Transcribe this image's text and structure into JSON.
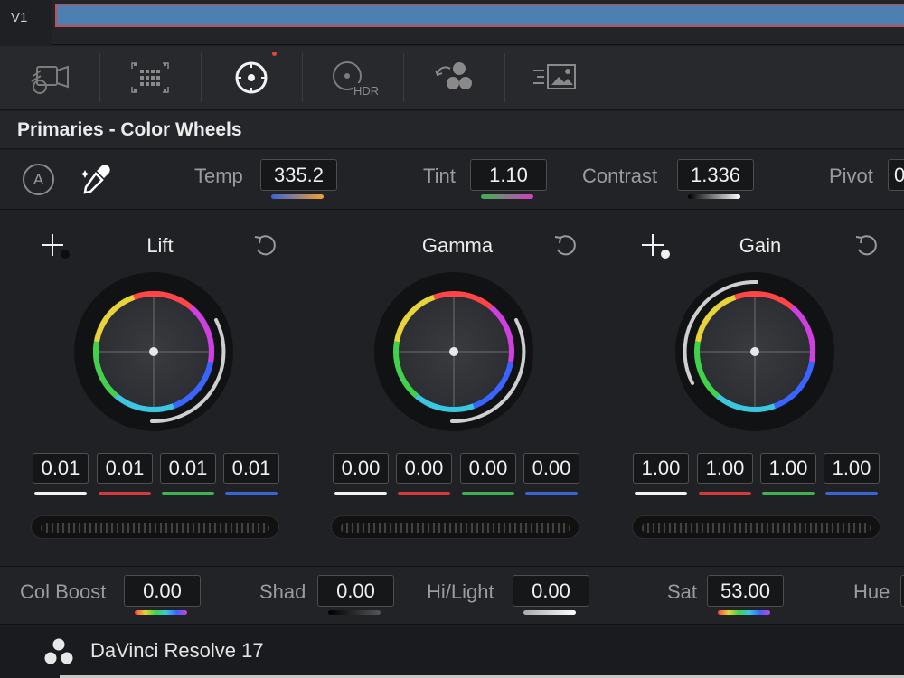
{
  "timeline": {
    "track_label": "V1"
  },
  "toolbar": {
    "tools": [
      {
        "name": "camera-raw-icon"
      },
      {
        "name": "color-match-icon"
      },
      {
        "name": "primaries-icon",
        "active": true
      },
      {
        "name": "hdr-icon",
        "text": "HDR"
      },
      {
        "name": "rgb-mixer-icon"
      },
      {
        "name": "motion-effects-icon"
      }
    ]
  },
  "palette": {
    "title": "Primaries - Color Wheels"
  },
  "adjust": {
    "auto_label": "A",
    "temp_label": "Temp",
    "temp_value": "335.2",
    "tint_label": "Tint",
    "tint_value": "1.10",
    "contrast_label": "Contrast",
    "contrast_value": "1.336",
    "pivot_label": "Pivot",
    "pivot_value": "0"
  },
  "wheels": [
    {
      "title": "Lift",
      "values": [
        "0.01",
        "0.01",
        "0.01",
        "0.01"
      ]
    },
    {
      "title": "Gamma",
      "values": [
        "0.00",
        "0.00",
        "0.00",
        "0.00"
      ]
    },
    {
      "title": "Gain",
      "values": [
        "1.00",
        "1.00",
        "1.00",
        "1.00"
      ]
    }
  ],
  "bottom": {
    "col_boost_label": "Col Boost",
    "col_boost_value": "0.00",
    "shad_label": "Shad",
    "shad_value": "0.00",
    "hilight_label": "Hi/Light",
    "hilight_value": "0.00",
    "sat_label": "Sat",
    "sat_value": "53.00",
    "hue_label": "Hue"
  },
  "footer": {
    "app_name": "DaVinci Resolve 17"
  },
  "colors": {
    "channel_y": "#f2f2f2",
    "channel_r": "#d23b3b",
    "channel_g": "#3fb24f",
    "channel_b": "#3a64d6",
    "clip": "#4d7fb0",
    "accent_red": "#e0493e"
  }
}
